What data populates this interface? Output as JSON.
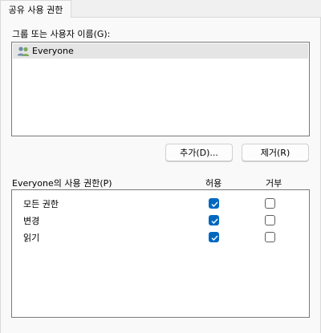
{
  "tab": {
    "label": "공유 사용 권한"
  },
  "group_section": {
    "label": "그룹 또는 사용자 이름(G):"
  },
  "users": [
    {
      "name": "Everyone",
      "icon": "users-icon"
    }
  ],
  "buttons": {
    "add": "추가(D)...",
    "remove": "제거(R)"
  },
  "permissions": {
    "label": "Everyone의 사용 권한(P)",
    "allow_header": "허용",
    "deny_header": "거부",
    "rows": [
      {
        "name": "모든 권한",
        "allow": true,
        "deny": false
      },
      {
        "name": "변경",
        "allow": true,
        "deny": false
      },
      {
        "name": "읽기",
        "allow": true,
        "deny": false
      }
    ]
  },
  "colors": {
    "accent": "#0067c0",
    "selection": "#e5e5e5"
  }
}
